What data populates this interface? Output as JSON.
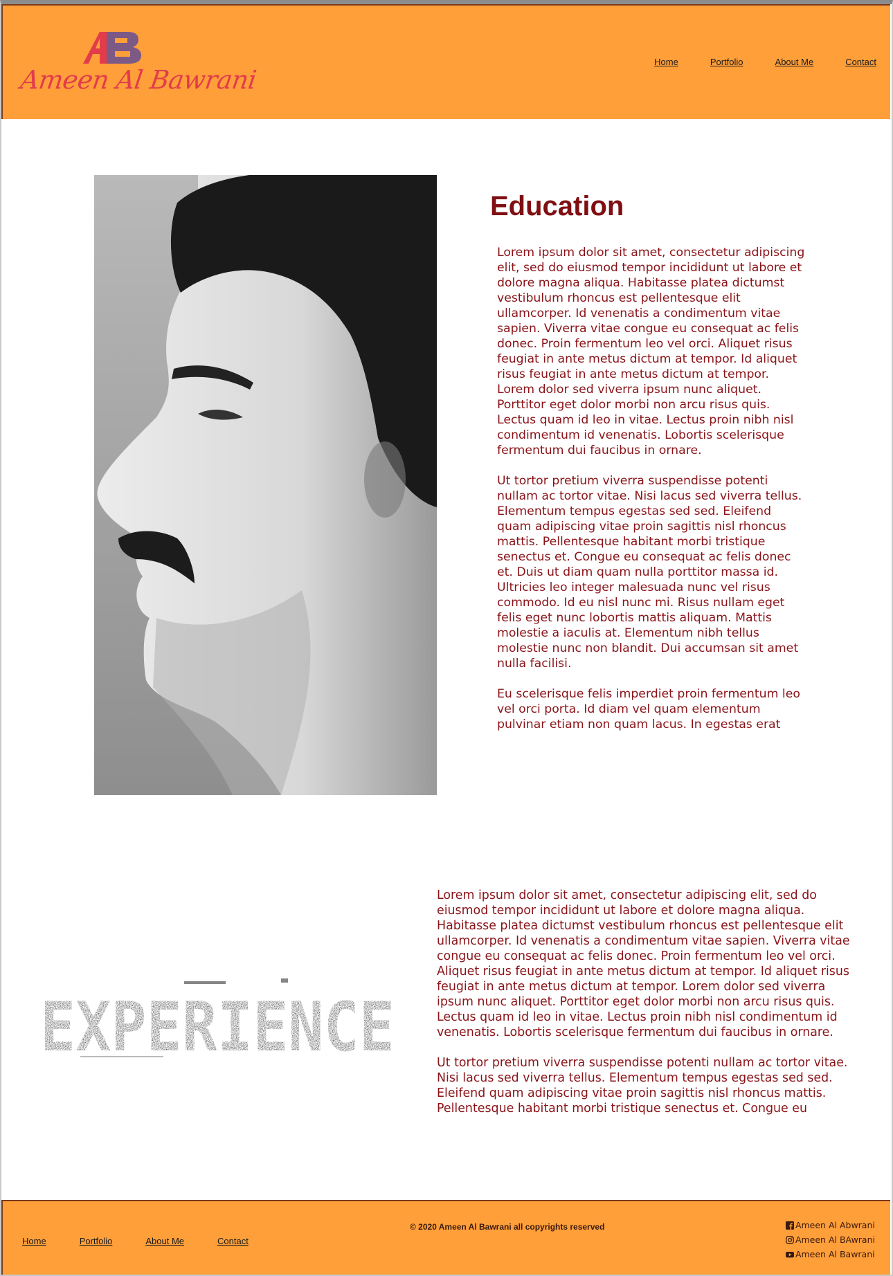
{
  "header": {
    "logo_text": "Ameen Al Bawrani",
    "logo_mark": "AB",
    "nav": [
      "Home",
      "Portfolio",
      "About Me",
      "Contact"
    ]
  },
  "education": {
    "title": "Education",
    "paragraphs": [
      "Lorem ipsum dolor sit amet, consectetur adipiscing elit, sed do eiusmod tempor incididunt ut labore et dolore magna aliqua. Habitasse platea dictumst vestibulum rhoncus est pellentesque elit ullamcorper. Id venenatis a condimentum vitae sapien. Viverra vitae congue eu consequat ac felis donec. Proin fermentum leo vel orci. Aliquet risus feugiat in ante metus dictum at tempor. Id aliquet risus feugiat in ante metus dictum at tempor. Lorem dolor sed viverra ipsum nunc aliquet. Porttitor eget dolor morbi non arcu risus quis. Lectus quam id leo in vitae. Lectus proin nibh nisl condimentum id venenatis. Lobortis scelerisque fermentum dui faucibus in ornare.",
      "Ut tortor pretium viverra suspendisse potenti nullam ac tortor vitae. Nisi lacus sed viverra tellus. Elementum tempus egestas sed sed. Eleifend quam adipiscing vitae proin sagittis nisl rhoncus mattis. Pellentesque habitant morbi tristique senectus et. Congue eu consequat ac felis donec et. Duis ut diam quam nulla porttitor massa id. Ultricies leo integer malesuada nunc vel risus commodo. Id eu nisl nunc mi. Risus nullam eget felis eget nunc lobortis mattis aliquam. Mattis molestie a iaculis at. Elementum nibh tellus molestie nunc non blandit. Dui accumsan sit amet nulla facilisi.",
      "Eu scelerisque felis imperdiet proin fermentum leo vel orci porta. Id diam vel quam elementum pulvinar etiam non quam lacus. In egestas erat"
    ]
  },
  "experience": {
    "heading_image_text": "EXPERIENCE",
    "paragraphs": [
      "Lorem ipsum dolor sit amet, consectetur adipiscing elit, sed do eiusmod tempor incididunt ut labore et dolore magna aliqua. Habitasse platea dictumst vestibulum rhoncus est pellentesque elit ullamcorper. Id venenatis a condimentum vitae sapien. Viverra vitae congue eu consequat ac felis donec. Proin fermentum leo vel orci. Aliquet risus feugiat in ante metus dictum at tempor. Id aliquet risus feugiat in ante metus dictum at tempor. Lorem dolor sed viverra ipsum nunc aliquet. Porttitor eget dolor morbi non arcu risus quis. Lectus quam id leo in vitae. Lectus proin nibh nisl condimentum id venenatis. Lobortis scelerisque fermentum dui faucibus in ornare.",
      "Ut tortor pretium viverra suspendisse potenti nullam ac tortor vitae. Nisi lacus sed viverra tellus. Elementum tempus egestas sed sed. Eleifend quam adipiscing vitae proin sagittis nisl rhoncus mattis. Pellentesque habitant morbi tristique senectus et. Congue eu"
    ]
  },
  "footer": {
    "copyright": "© 2020 Ameen Al Bawrani all copyrights reserved",
    "nav": [
      "Home",
      "Portfolio",
      "About Me",
      "Contact"
    ],
    "social": [
      {
        "icon": "facebook-icon",
        "label": "Ameen Al Abwrani"
      },
      {
        "icon": "instagram-icon",
        "label": "Ameen Al BAwrani"
      },
      {
        "icon": "youtube-icon",
        "label": "Ameen Al Bawrani"
      }
    ]
  },
  "colors": {
    "header_bg": "#ff9f3a",
    "accent_text": "#8a1419",
    "title": "#7f0f12",
    "logo_red": "#e23c4b",
    "logo_purple": "#7d5a86"
  }
}
